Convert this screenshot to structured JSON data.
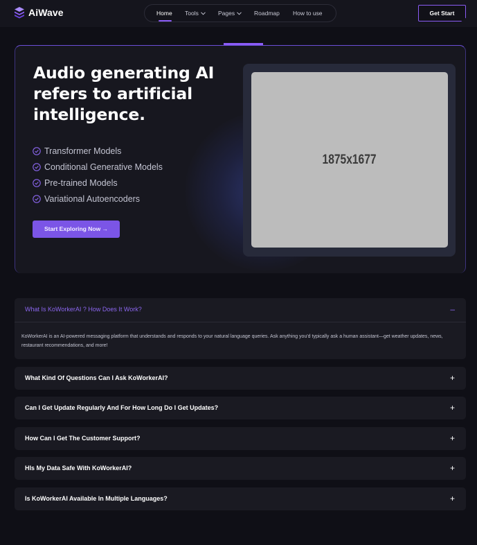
{
  "header": {
    "brand": "AiWave",
    "nav": [
      {
        "label": "Home",
        "active": true,
        "dropdown": false
      },
      {
        "label": "Tools",
        "active": false,
        "dropdown": true
      },
      {
        "label": "Pages",
        "active": false,
        "dropdown": true
      },
      {
        "label": "Roadmap",
        "active": false,
        "dropdown": false
      },
      {
        "label": "How to use",
        "active": false,
        "dropdown": false
      }
    ],
    "cta_label": "Get Start"
  },
  "hero": {
    "title": "Audio generating AI refers to artificial intelligence.",
    "features": [
      "Transformer Models",
      "Conditional Generative Models",
      "Pre-trained Models",
      "Variational Autoencoders"
    ],
    "cta_label": "Start Exploring Now →",
    "image_placeholder": "1875x1677"
  },
  "faq": [
    {
      "question": "What Is KoWorkerAI ? How Does It Work?",
      "open": true,
      "toggle": "–",
      "answer": "KoWorkerAI is an AI-powered messaging platform that understands and responds to your natural language queries. Ask anything you'd typically ask a human assistant—get weather updates, news, restaurant recommendations, and more!"
    },
    {
      "question": "What Kind Of Questions Can I Ask KoWorkerAI?",
      "open": false,
      "toggle": "+"
    },
    {
      "question": "Can I Get Update Regularly And For How Long Do I Get Updates?",
      "open": false,
      "toggle": "+"
    },
    {
      "question": "How Can I Get The Customer Support?",
      "open": false,
      "toggle": "+"
    },
    {
      "question": "HIs My Data Safe With KoWorkerAI?",
      "open": false,
      "toggle": "+"
    },
    {
      "question": "Is KoWorkerAI Available In Multiple Languages?",
      "open": false,
      "toggle": "+"
    }
  ],
  "colors": {
    "accent": "#8b5cf6",
    "background": "#0f0f16",
    "card": "#1a1a22"
  }
}
